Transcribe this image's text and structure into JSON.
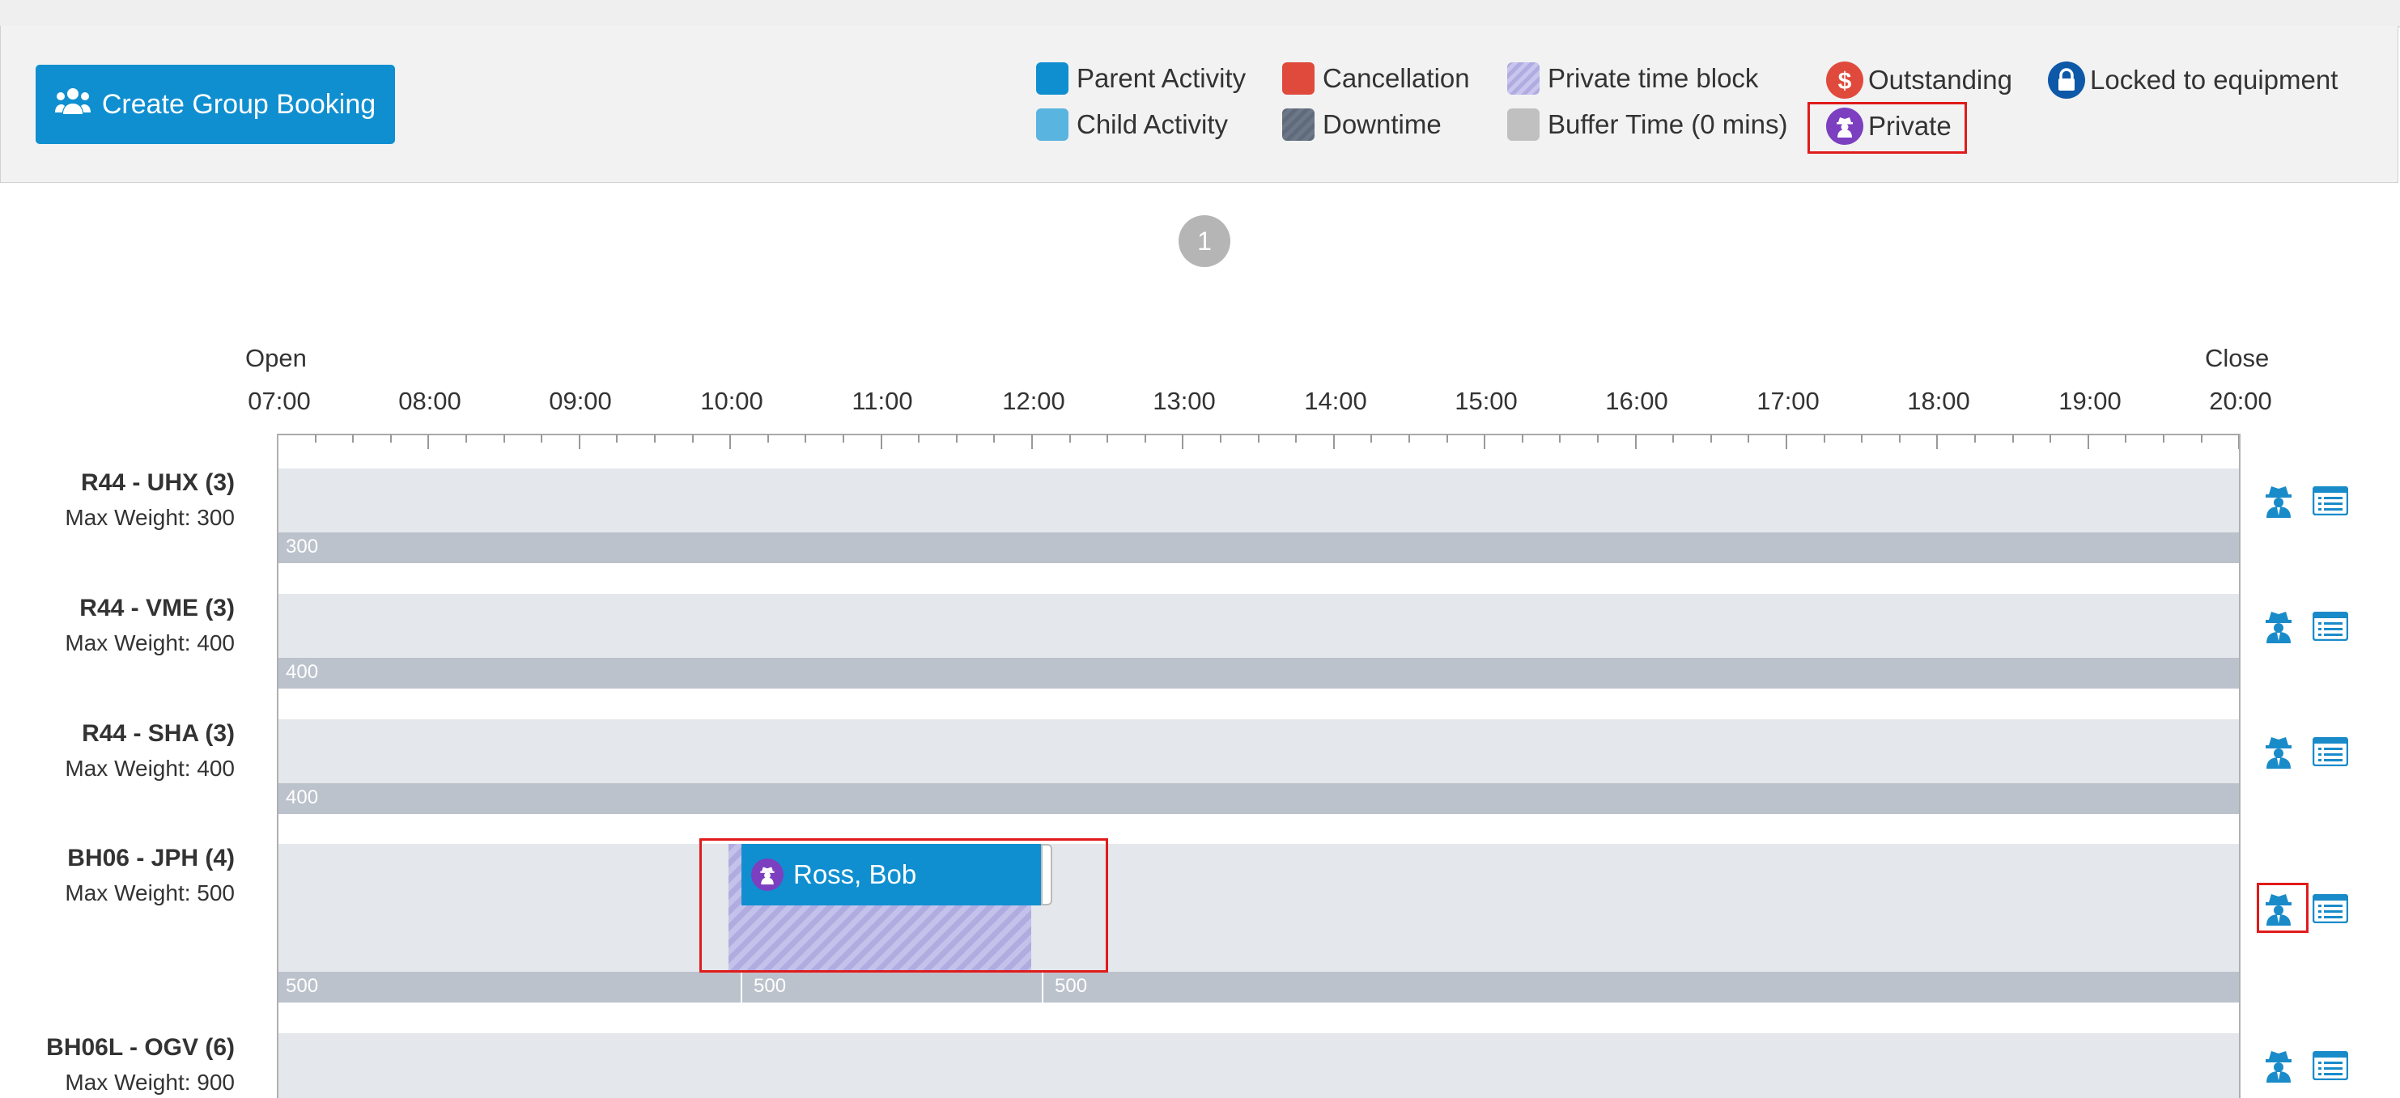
{
  "toolbar": {
    "create_button_label": "Create Group Booking"
  },
  "legend": {
    "parent_activity": "Parent Activity",
    "child_activity": "Child Activity",
    "cancellation": "Cancellation",
    "downtime": "Downtime",
    "private_time_block": "Private time block",
    "buffer_time": "Buffer Time (0 mins)",
    "outstanding": "Outstanding",
    "private": "Private",
    "locked_to_equipment": "Locked to equipment"
  },
  "colors": {
    "parent_activity": "#0f8fd0",
    "child_activity": "#5ab4e0",
    "cancellation": "#e04a3c",
    "downtime": "#5f6b7a",
    "private_time_block": "#b0ace0",
    "buffer_time": "#c0c0c0",
    "outstanding": "#e04a3c",
    "private": "#7b3fc0",
    "locked": "#0e58a8"
  },
  "pager": {
    "current_page": "1"
  },
  "timeline": {
    "open_label": "Open",
    "close_label": "Close",
    "hours": [
      "07:00",
      "08:00",
      "09:00",
      "10:00",
      "11:00",
      "12:00",
      "13:00",
      "14:00",
      "15:00",
      "16:00",
      "17:00",
      "18:00",
      "19:00",
      "20:00"
    ]
  },
  "resources": [
    {
      "name": "R44 - UHX (3)",
      "max_weight": "Max Weight: 300",
      "weight_segments": [
        "300"
      ]
    },
    {
      "name": "R44 - VME (3)",
      "max_weight": "Max Weight: 400",
      "weight_segments": [
        "400"
      ]
    },
    {
      "name": "R44 - SHA (3)",
      "max_weight": "Max Weight: 400",
      "weight_segments": [
        "400"
      ]
    },
    {
      "name": "BH06 - JPH (4)",
      "max_weight": "Max Weight: 500",
      "weight_segments": [
        "500",
        "500",
        "500"
      ]
    },
    {
      "name": "BH06L - OGV (6)",
      "max_weight": "Max Weight: 900"
    }
  ],
  "booking": {
    "customer": "Ross, Bob",
    "start": "10:00",
    "end": "12:00",
    "private": true
  },
  "icons": {
    "create": "users-icon",
    "private": "spy-icon",
    "details": "list-icon",
    "outstanding": "dollar-icon",
    "locked": "lock-icon"
  }
}
